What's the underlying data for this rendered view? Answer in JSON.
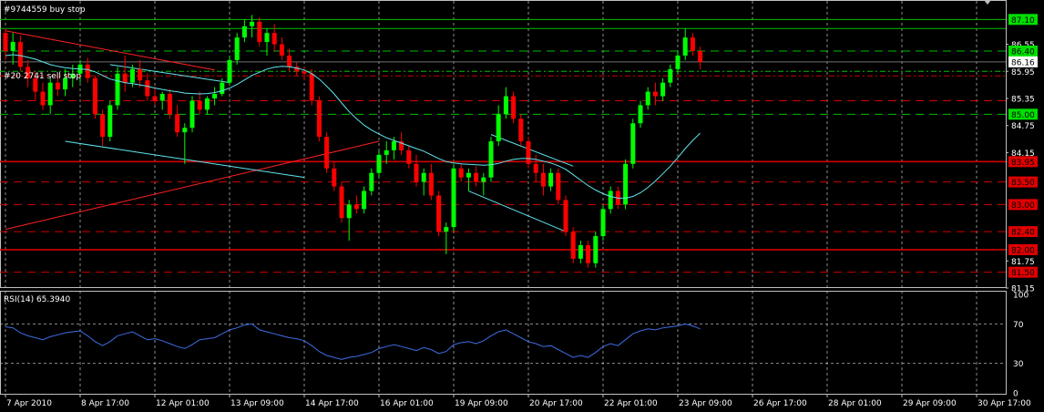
{
  "colors": {
    "background": "#000000",
    "frame": "#c0c0c0",
    "grid": "#c8c8c8",
    "bull": "#00ff00",
    "bear": "#ff0000",
    "ma": "#5fe6ee",
    "rsi": "#3d6de3",
    "trend_red": "#ff2020",
    "trend_cyan": "#5fe6ee",
    "axis_text": "#ffffff",
    "green_line": "#00c000",
    "red_line": "#d00000",
    "buy_label_bg": "#00e000",
    "sell_label_bg": "#e00000"
  },
  "orders": {
    "buy_stop_label": "#9744559 buy stop",
    "sell_stop_label": "#20 2741 sell stop"
  },
  "chart_data": [
    {
      "type": "candlestick",
      "ylim": [
        81.15,
        87.45
      ],
      "y_ticks": [
        "87.10",
        "86.55",
        "86.40",
        "86.16",
        "85.95",
        "85.35",
        "85.00",
        "84.75",
        "84.15",
        "83.95",
        "83.50",
        "83.00",
        "82.40",
        "82.00",
        "81.75",
        "81.50",
        "81.15"
      ],
      "price_level_lines": [
        {
          "value": 87.1,
          "style": "solid",
          "color": "green",
          "label": "87.10",
          "label_type": "box_green"
        },
        {
          "value": 86.9,
          "style": "solid",
          "color": "green"
        },
        {
          "value": 86.4,
          "style": "dash",
          "color": "green",
          "label": "86.40",
          "label_type": "box_green"
        },
        {
          "value": 86.16,
          "style": "solid",
          "color": "gray",
          "label": "86.16",
          "label_type": "box_white"
        },
        {
          "value": 85.95,
          "style": "dashdot",
          "color": "green"
        },
        {
          "value": 85.85,
          "style": "dashdot",
          "color": "red"
        },
        {
          "value": 85.3,
          "style": "dash",
          "color": "red"
        },
        {
          "value": 85.0,
          "style": "dash",
          "color": "green",
          "label": "85.00",
          "label_type": "box_green"
        },
        {
          "value": 83.95,
          "style": "solid",
          "color": "red",
          "label": "83.95",
          "label_type": "box_red"
        },
        {
          "value": 83.5,
          "style": "dash",
          "color": "red",
          "label": "83.50",
          "label_type": "box_red"
        },
        {
          "value": 83.0,
          "style": "dash",
          "color": "red",
          "label": "83.00",
          "label_type": "box_red"
        },
        {
          "value": 82.4,
          "style": "dash",
          "color": "red",
          "label": "82.40",
          "label_type": "box_red"
        },
        {
          "value": 82.0,
          "style": "solid",
          "color": "red",
          "label": "82.00",
          "label_type": "box_red"
        },
        {
          "value": 81.5,
          "style": "dash",
          "color": "red",
          "label": "81.50",
          "label_type": "box_red"
        }
      ],
      "x_tick_labels": [
        "7 Apr 2010",
        "8 Apr 17:00",
        "12 Apr 01:00",
        "13 Apr 09:00",
        "14 Apr 17:00",
        "16 Apr 01:00",
        "19 Apr 09:00",
        "20 Apr 17:00",
        "22 Apr 01:00",
        "23 Apr 09:00",
        "26 Apr 17:00",
        "28 Apr 01:00",
        "29 Apr 09:00",
        "30 Apr 17:00"
      ],
      "x_tick_bars": [
        0,
        10,
        20,
        30,
        40,
        50,
        60,
        70,
        80,
        90,
        100,
        110,
        120,
        130
      ],
      "candles": [
        [
          86.8,
          86.9,
          86.2,
          86.4
        ],
        [
          86.4,
          86.8,
          86.1,
          86.6
        ],
        [
          86.6,
          86.75,
          85.95,
          86.05
        ],
        [
          86.05,
          86.2,
          85.6,
          85.8
        ],
        [
          85.8,
          85.95,
          85.3,
          85.5
        ],
        [
          85.5,
          85.7,
          85.1,
          85.2
        ],
        [
          85.2,
          85.8,
          85.0,
          85.7
        ],
        [
          85.7,
          85.9,
          85.4,
          85.55
        ],
        [
          85.55,
          86.0,
          85.4,
          85.8
        ],
        [
          85.8,
          86.1,
          85.6,
          85.9
        ],
        [
          85.9,
          86.2,
          85.7,
          86.1
        ],
        [
          86.1,
          86.25,
          85.7,
          85.8
        ],
        [
          85.8,
          85.85,
          84.9,
          85.0
        ],
        [
          85.0,
          85.1,
          84.3,
          84.5
        ],
        [
          84.5,
          85.3,
          84.4,
          85.2
        ],
        [
          85.2,
          86.05,
          85.1,
          85.9
        ],
        [
          85.9,
          86.3,
          85.5,
          85.7
        ],
        [
          85.7,
          86.1,
          85.6,
          86.0
        ],
        [
          86.0,
          86.2,
          85.6,
          85.75
        ],
        [
          85.75,
          85.9,
          85.3,
          85.4
        ],
        [
          85.4,
          85.6,
          85.2,
          85.3
        ],
        [
          85.3,
          85.5,
          85.1,
          85.45
        ],
        [
          85.45,
          85.55,
          84.9,
          85.0
        ],
        [
          85.0,
          85.2,
          84.5,
          84.6
        ],
        [
          84.6,
          84.8,
          83.9,
          84.7
        ],
        [
          84.7,
          85.4,
          84.6,
          85.3
        ],
        [
          85.3,
          85.5,
          85.0,
          85.1
        ],
        [
          85.1,
          85.4,
          85.0,
          85.35
        ],
        [
          85.35,
          85.6,
          85.2,
          85.45
        ],
        [
          85.45,
          85.8,
          85.4,
          85.7
        ],
        [
          85.7,
          86.3,
          85.65,
          86.2
        ],
        [
          86.2,
          86.8,
          86.1,
          86.7
        ],
        [
          86.7,
          87.1,
          86.6,
          86.95
        ],
        [
          86.95,
          87.2,
          86.7,
          87.05
        ],
        [
          87.05,
          87.15,
          86.5,
          86.6
        ],
        [
          86.6,
          86.9,
          86.3,
          86.8
        ],
        [
          86.8,
          87.0,
          86.4,
          86.55
        ],
        [
          86.55,
          86.7,
          86.2,
          86.3
        ],
        [
          86.3,
          86.45,
          85.95,
          86.05
        ],
        [
          86.05,
          86.15,
          85.85,
          85.95
        ],
        [
          85.95,
          86.05,
          85.75,
          85.9
        ],
        [
          85.9,
          86.0,
          85.2,
          85.3
        ],
        [
          85.3,
          85.4,
          84.4,
          84.5
        ],
        [
          84.5,
          84.6,
          83.7,
          83.8
        ],
        [
          83.8,
          83.95,
          83.3,
          83.4
        ],
        [
          83.4,
          83.5,
          82.6,
          82.7
        ],
        [
          82.7,
          83.1,
          82.2,
          83.0
        ],
        [
          83.0,
          83.2,
          82.8,
          82.9
        ],
        [
          82.9,
          83.4,
          82.8,
          83.3
        ],
        [
          83.3,
          83.8,
          83.2,
          83.7
        ],
        [
          83.7,
          84.2,
          83.6,
          84.1
        ],
        [
          84.1,
          84.4,
          83.9,
          84.2
        ],
        [
          84.2,
          84.5,
          84.0,
          84.4
        ],
        [
          84.4,
          84.6,
          84.1,
          84.2
        ],
        [
          84.2,
          84.3,
          83.8,
          83.9
        ],
        [
          83.9,
          84.1,
          83.4,
          83.5
        ],
        [
          83.5,
          83.8,
          83.2,
          83.7
        ],
        [
          83.7,
          83.9,
          83.1,
          83.2
        ],
        [
          83.2,
          83.3,
          82.3,
          82.4
        ],
        [
          82.4,
          82.6,
          81.9,
          82.5
        ],
        [
          82.5,
          83.9,
          82.4,
          83.8
        ],
        [
          83.8,
          83.9,
          83.5,
          83.6
        ],
        [
          83.6,
          83.8,
          83.3,
          83.7
        ],
        [
          83.7,
          83.85,
          83.4,
          83.5
        ],
        [
          83.5,
          83.7,
          83.2,
          83.6
        ],
        [
          83.6,
          84.5,
          83.5,
          84.4
        ],
        [
          84.4,
          85.2,
          84.3,
          85.0
        ],
        [
          85.0,
          85.6,
          84.9,
          85.4
        ],
        [
          85.4,
          85.5,
          84.8,
          84.9
        ],
        [
          84.9,
          85.0,
          84.3,
          84.4
        ],
        [
          84.4,
          84.5,
          83.8,
          83.9
        ],
        [
          83.9,
          84.1,
          83.5,
          83.7
        ],
        [
          83.7,
          83.9,
          83.2,
          83.4
        ],
        [
          83.4,
          83.8,
          83.3,
          83.7
        ],
        [
          83.7,
          83.8,
          83.0,
          83.1
        ],
        [
          83.1,
          83.2,
          82.3,
          82.4
        ],
        [
          82.4,
          82.5,
          81.7,
          81.8
        ],
        [
          81.8,
          82.2,
          81.7,
          82.1
        ],
        [
          82.1,
          82.2,
          81.6,
          81.7
        ],
        [
          81.7,
          82.4,
          81.6,
          82.3
        ],
        [
          82.3,
          83.0,
          82.2,
          82.9
        ],
        [
          82.9,
          83.4,
          82.8,
          83.3
        ],
        [
          83.3,
          83.4,
          82.9,
          83.0
        ],
        [
          83.0,
          84.0,
          82.9,
          83.9
        ],
        [
          83.9,
          84.9,
          83.8,
          84.8
        ],
        [
          84.8,
          85.3,
          84.7,
          85.2
        ],
        [
          85.2,
          85.6,
          85.1,
          85.5
        ],
        [
          85.5,
          85.7,
          85.2,
          85.4
        ],
        [
          85.4,
          85.8,
          85.3,
          85.7
        ],
        [
          85.7,
          86.1,
          85.6,
          86.0
        ],
        [
          86.0,
          86.4,
          85.9,
          86.3
        ],
        [
          86.3,
          86.9,
          86.2,
          86.7
        ],
        [
          86.7,
          86.8,
          86.3,
          86.4
        ],
        [
          86.4,
          86.5,
          86.0,
          86.16
        ]
      ],
      "moving_average": [
        86.3,
        86.32,
        86.3,
        86.26,
        86.22,
        86.16,
        86.1,
        86.06,
        86.03,
        86.01,
        86.0,
        85.99,
        85.94,
        85.86,
        85.78,
        85.74,
        85.7,
        85.68,
        85.65,
        85.62,
        85.58,
        85.55,
        85.52,
        85.5,
        85.47,
        85.46,
        85.45,
        85.46,
        85.48,
        85.52,
        85.58,
        85.66,
        85.76,
        85.86,
        85.93,
        86.0,
        86.04,
        86.06,
        86.05,
        86.02,
        85.98,
        85.9,
        85.78,
        85.62,
        85.45,
        85.25,
        85.06,
        84.9,
        84.76,
        84.65,
        84.56,
        84.48,
        84.42,
        84.36,
        84.3,
        84.24,
        84.18,
        84.1,
        84.02,
        83.95,
        83.92,
        83.9,
        83.89,
        83.88,
        83.87,
        83.88,
        83.91,
        83.96,
        84.0,
        84.02,
        84.02,
        84.0,
        83.96,
        83.92,
        83.86,
        83.78,
        83.66,
        83.54,
        83.42,
        83.32,
        83.24,
        83.18,
        83.14,
        83.14,
        83.18,
        83.26,
        83.38,
        83.52,
        83.68,
        83.85,
        84.04,
        84.24,
        84.42,
        84.58
      ],
      "trendlines": [
        {
          "color": "red",
          "from": [
            0,
            86.85
          ],
          "to": [
            28,
            85.98
          ]
        },
        {
          "color": "red",
          "from": [
            0,
            82.45
          ],
          "to": [
            50,
            84.4
          ]
        },
        {
          "color": "cyan",
          "from": [
            8,
            84.4
          ],
          "to": [
            40,
            83.6
          ]
        },
        {
          "color": "cyan",
          "from": [
            14,
            86.1
          ],
          "to": [
            30,
            85.7
          ]
        },
        {
          "color": "cyan",
          "from": [
            65,
            84.55
          ],
          "to": [
            76,
            83.85
          ]
        },
        {
          "color": "cyan",
          "from": [
            62,
            83.3
          ],
          "to": [
            75,
            82.4
          ]
        }
      ]
    },
    {
      "type": "line",
      "title": "RSI(14) 65.3940",
      "ylim": [
        0,
        100
      ],
      "y_ticks": [
        100,
        70,
        30,
        0
      ],
      "levels": [
        70,
        30
      ],
      "values": [
        67,
        66,
        61,
        58,
        56,
        54,
        57,
        59,
        61,
        62,
        63,
        58,
        52,
        48,
        52,
        58,
        60,
        62,
        58,
        54,
        55,
        53,
        50,
        47,
        45,
        49,
        54,
        55,
        56,
        60,
        64,
        66,
        69,
        70,
        64,
        62,
        60,
        58,
        56,
        55,
        53,
        48,
        42,
        38,
        36,
        34,
        36,
        37,
        39,
        41,
        45,
        47,
        49,
        47,
        45,
        43,
        46,
        44,
        40,
        42,
        49,
        51,
        52,
        50,
        53,
        58,
        62,
        64,
        60,
        56,
        52,
        50,
        47,
        48,
        44,
        40,
        36,
        38,
        36,
        41,
        47,
        50,
        48,
        54,
        60,
        63,
        65,
        64,
        66,
        67,
        68,
        70,
        68,
        65
      ]
    }
  ]
}
